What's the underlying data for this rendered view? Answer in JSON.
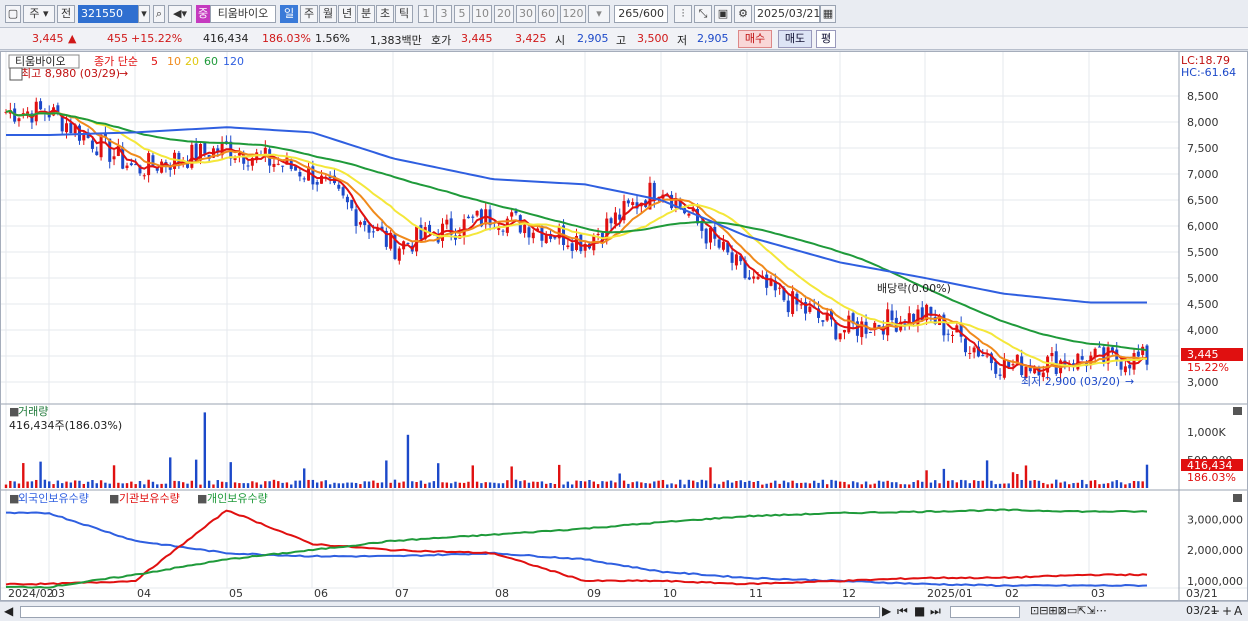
{
  "toolbar": {
    "market": "주",
    "prev": "전",
    "code": "321550",
    "stock_name_badge": "중",
    "stock_name": "티움바이오",
    "periods": [
      "일",
      "주",
      "월",
      "년",
      "분",
      "초",
      "틱"
    ],
    "active_period": "일",
    "intervals": [
      "1",
      "3",
      "5",
      "10",
      "20",
      "30",
      "60",
      "120"
    ],
    "count": "265",
    "count_total": "/600",
    "date": "2025/03/21"
  },
  "quote": {
    "price": "3,445",
    "change_arrow": "▲",
    "change": "455",
    "change_pct": "+15.22%",
    "volume": "416,434",
    "volume_ratio": "186.03%",
    "turnover": "1.56%",
    "amount": "1,383백만",
    "ask_label": "호가",
    "ask": "3,445",
    "bid": "3,425",
    "open_label": "시",
    "open": "2,905",
    "high_label": "고",
    "high": "3,500",
    "low_label": "저",
    "low": "2,905",
    "buy_label": "매수",
    "sell_label": "매도",
    "eval_label": "평"
  },
  "chart": {
    "title": "티움바이오",
    "legend_prefix": "종가 단순",
    "ma_periods": [
      "5",
      "10",
      "20",
      "60",
      "120"
    ],
    "ma_colors": {
      "ma5": "#e01010",
      "ma10": "#f08a1c",
      "ma20": "#f4e73a",
      "ma60": "#1f9a3a",
      "ma120": "#2f5fe0"
    },
    "up_color": "#e01010",
    "down_color": "#1c49c9",
    "lc": "LC:18.79",
    "hc": "HC:-61.64",
    "high_annot": "최고 8,980 (03/29)",
    "low_annot": "최저 2,900 (03/20)",
    "dividend_annot": "배당락(0.00%)",
    "last_price": "3,445",
    "last_pct": "15.22%",
    "price_ticks": [
      "8,500",
      "8,000",
      "7,500",
      "7,000",
      "6,500",
      "6,000",
      "5,500",
      "5,000",
      "4,500",
      "4,000",
      "3,500",
      "3,000"
    ],
    "volume_title": "거래량",
    "volume_info": "416,434주(186.03%)",
    "volume_ticks": [
      "1,000K",
      "500,000"
    ],
    "volume_last": "416,434",
    "volume_last_pct": "186.03%",
    "holdings_legend": [
      "외국인보유수량",
      "기관보유수량",
      "개인보유수량"
    ],
    "holdings_colors": [
      "#2f5fe0",
      "#e01010",
      "#1f9a3a"
    ],
    "holdings_ticks": [
      "3,000,000",
      "2,000,000",
      "1,000,000"
    ],
    "x_labels": [
      "2024/02",
      "03",
      "04",
      "05",
      "06",
      "07",
      "08",
      "09",
      "10",
      "11",
      "12",
      "2025/01",
      "02",
      "03"
    ],
    "x_end": "03/21"
  },
  "chart_data": {
    "type": "line",
    "title": "",
    "xlabel": "",
    "ylabel": "",
    "ylim": [
      2900,
      8980
    ],
    "x": [
      "2024-03",
      "2024-04",
      "2024-05",
      "2024-06",
      "2024-07",
      "2024-08",
      "2024-09",
      "2024-10",
      "2024-11",
      "2024-12",
      "2025-01",
      "2025-02",
      "2025-03"
    ],
    "series": [
      {
        "name": "종가",
        "values": [
          8200,
          7100,
          7500,
          7000,
          5600,
          6200,
          5700,
          6800,
          5000,
          4000,
          4300,
          3300,
          3445
        ]
      },
      {
        "name": "120",
        "values": [
          7750,
          7800,
          7900,
          7800,
          7300,
          6900,
          6800,
          6500,
          5800,
          5300,
          5000,
          4700,
          4530
        ]
      }
    ],
    "volume": {
      "last": 416434,
      "max_tick": 1000000
    },
    "holdings": [
      {
        "name": "외국인보유수량",
        "values": [
          3200000,
          2300000,
          1900000,
          1800000,
          1800000,
          1900000,
          1700000,
          1300000,
          1100000,
          1000000,
          900000,
          850000,
          850000
        ]
      },
      {
        "name": "기관보유수량",
        "values": [
          900000,
          1000000,
          3300000,
          2200000,
          2000000,
          1900000,
          1000000,
          1000000,
          900000,
          1000000,
          1100000,
          1100000,
          1200000
        ]
      },
      {
        "name": "개인보유수량",
        "values": [
          800000,
          1200000,
          1700000,
          2000000,
          2300000,
          2500000,
          2700000,
          2900000,
          3100000,
          3200000,
          3250000,
          3300000,
          3250000
        ]
      }
    ]
  },
  "bottom": {
    "end_label": "03/21",
    "controls": [
      "▶",
      "⏮",
      "■",
      "⏭"
    ]
  }
}
